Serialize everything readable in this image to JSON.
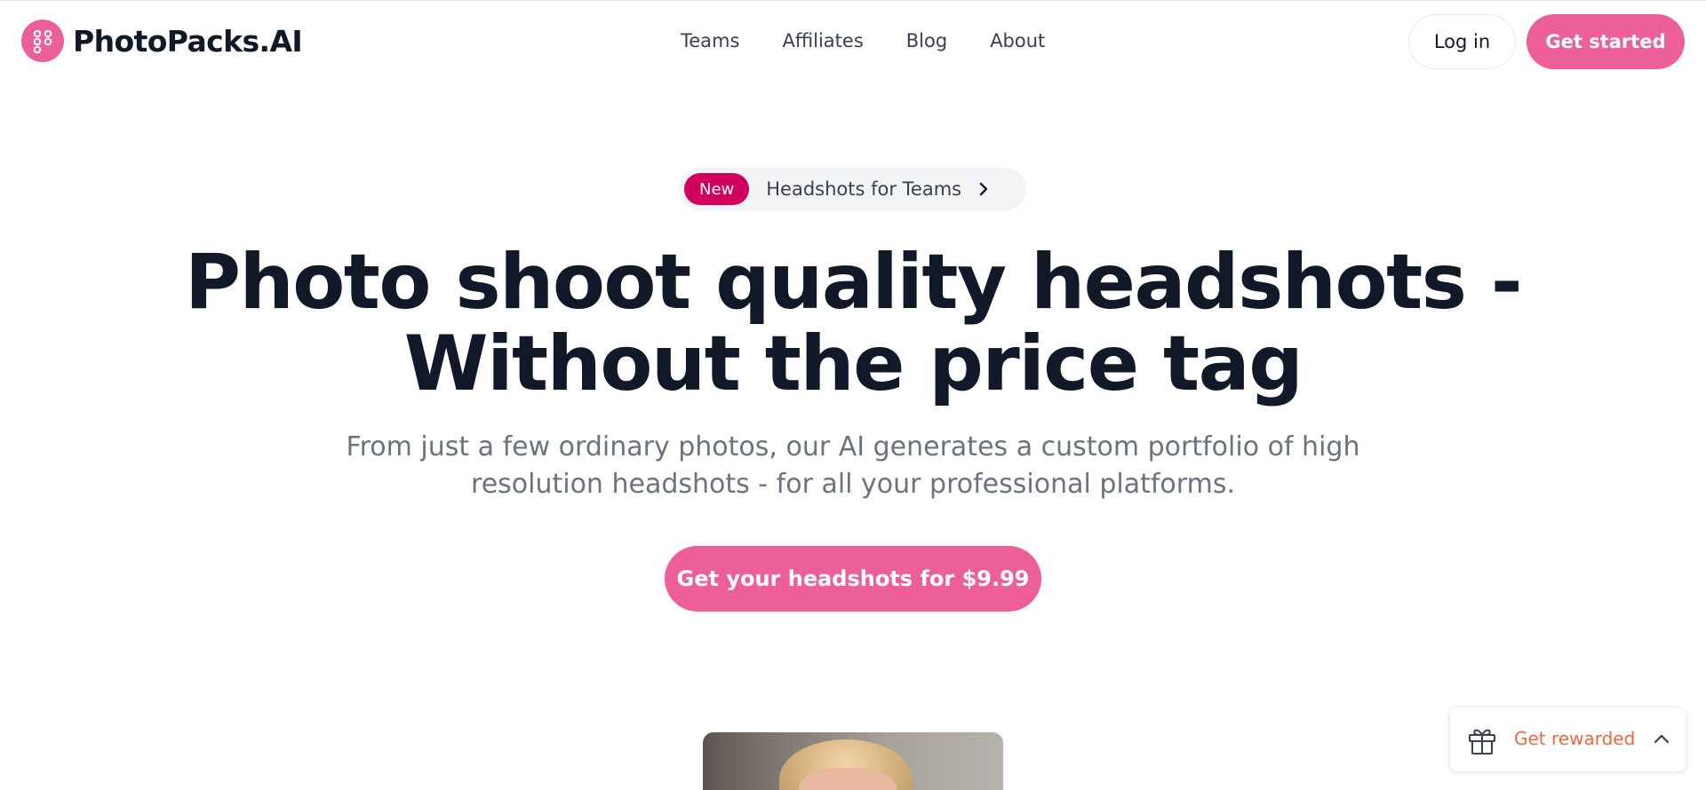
{
  "brand": {
    "name": "PhotoPacks.AI",
    "accent_color": "#ec5f99",
    "badge_color": "#d1005e",
    "reward_color": "#f0683d"
  },
  "nav": {
    "links": [
      "Teams",
      "Affiliates",
      "Blog",
      "About"
    ],
    "login_label": "Log in",
    "cta_label": "Get started"
  },
  "announcement": {
    "badge": "New",
    "text": "Headshots for Teams",
    "icon": "chevron-right-icon"
  },
  "hero": {
    "title_lines": [
      "Photo shoot quality headshots -",
      "Without the price tag"
    ],
    "subtitle_lines": [
      "From just a few ordinary photos, our AI generates a custom portfolio of high",
      "resolution headshots - for all your professional platforms."
    ],
    "cta_label": "Get your headshots for $9.99"
  },
  "rewards": {
    "label": "Get rewarded",
    "icon": "gift-icon",
    "toggle_icon": "chevron-up-icon"
  }
}
